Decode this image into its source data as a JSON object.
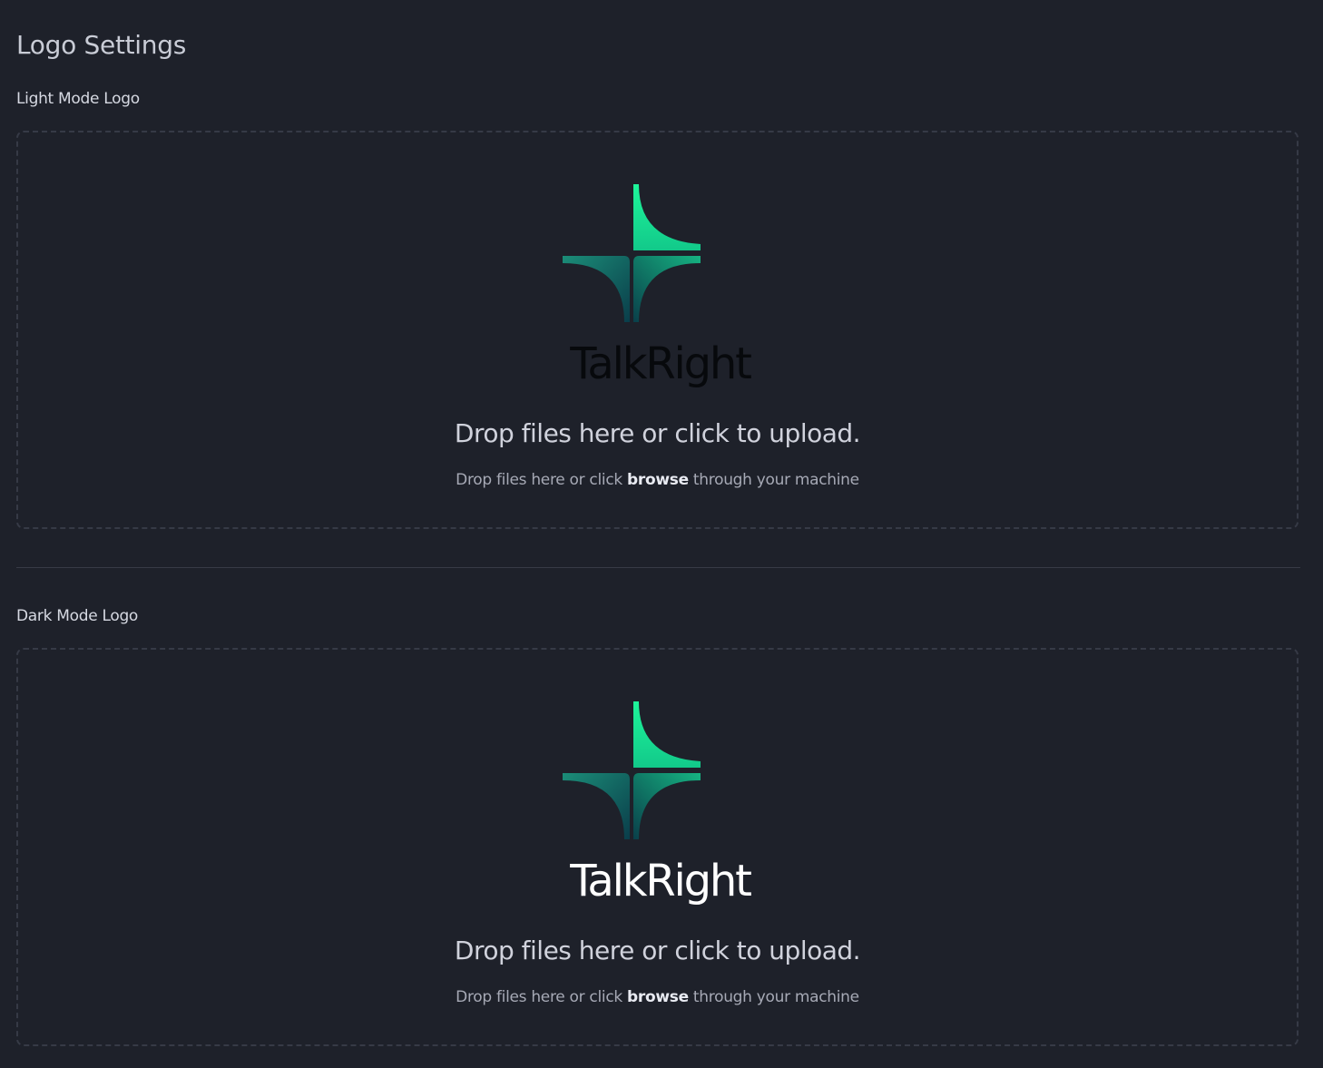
{
  "page": {
    "title": "Logo Settings"
  },
  "light_mode": {
    "label": "Light Mode Logo",
    "wordmark": "TalkRight",
    "wordmark_color": "#07090c",
    "drop_title": "Drop files here or click to upload.",
    "drop_sub_prefix": "Drop files here or click ",
    "drop_sub_link": "browse",
    "drop_sub_suffix": " through your machine"
  },
  "dark_mode": {
    "label": "Dark Mode Logo",
    "wordmark": "TalkRight",
    "wordmark_color": "#ffffff",
    "drop_title": "Drop files here or click to upload.",
    "drop_sub_prefix": "Drop files here or click ",
    "drop_sub_link": "browse",
    "drop_sub_suffix": " through your machine"
  },
  "colors": {
    "background": "#1e212a",
    "logo_green_light": "#1ef08c",
    "logo_green_dark": "#0a4a4a"
  }
}
